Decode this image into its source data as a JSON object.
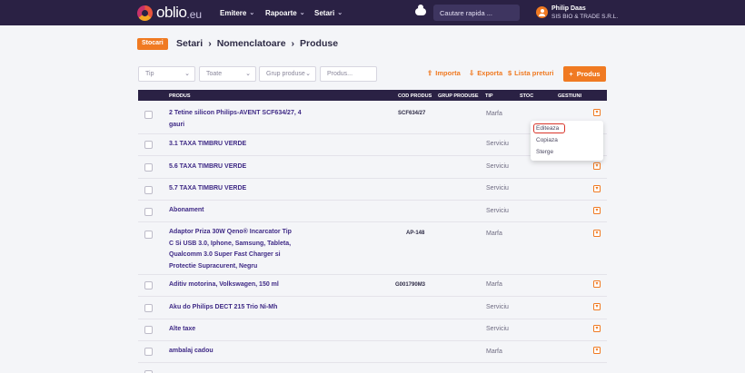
{
  "nav": {
    "logo_text": "oblio",
    "logo_tld": ".eu",
    "menu": [
      {
        "label": "Emitere"
      },
      {
        "label": "Rapoarte"
      },
      {
        "label": "Setari"
      }
    ],
    "search_placeholder": "Cautare rapida ...",
    "user_name": "Philip Daas",
    "user_company": "SIS BIO & TRADE S.R.L."
  },
  "breadcrumb": {
    "badge": "Stocari",
    "items": [
      "Setari",
      "Nomenclatoare",
      "Produse"
    ],
    "separator": "›"
  },
  "filters": {
    "tip": "Tip",
    "toate": "Toate",
    "grup": "Grup produse",
    "produs_placeholder": "Produs..."
  },
  "actions": {
    "importa": "Importa",
    "exporta": "Exporta",
    "lista_preturi": "Lista preturi",
    "add_produs": "Produs"
  },
  "table": {
    "headers": {
      "produs": "PRODUS",
      "cod": "COD PRODUS",
      "grup": "GRUP PRODUSE",
      "tip": "TIP",
      "stoc": "STOC",
      "gestiuni": "GESTIUNI"
    },
    "rows": [
      {
        "name": "2 Tetine silicon Philips-AVENT SCF634/27, 4 gauri",
        "code": "SCF634/27",
        "type": "Marfa"
      },
      {
        "name": "3.1 TAXA TIMBRU VERDE",
        "code": "",
        "type": "Serviciu"
      },
      {
        "name": "5.6 TAXA TIMBRU VERDE",
        "code": "",
        "type": "Serviciu"
      },
      {
        "name": "5.7 TAXA TIMBRU VERDE",
        "code": "",
        "type": "Serviciu"
      },
      {
        "name": "Abonament",
        "code": "",
        "type": "Serviciu"
      },
      {
        "name": "Adaptor Priza 30W Qeno® Incarcator Tip C Si USB 3.0, Iphone, Samsung, Tableta, Qualcomm 3.0 Super Fast Charger si Protectie Supracurent, Negru",
        "code": "AP-148",
        "type": "Marfa"
      },
      {
        "name": "Aditiv motorina, Volkswagen, 150 ml",
        "code": "G001790M3",
        "type": "Marfa"
      },
      {
        "name": "Aku do Philips DECT 215 Trio Ni-Mh",
        "code": "",
        "type": "Serviciu"
      },
      {
        "name": "Alte taxe",
        "code": "",
        "type": "Serviciu"
      },
      {
        "name": "ambalaj cadou",
        "code": "",
        "type": "Marfa"
      }
    ]
  },
  "row_menu": {
    "items": [
      "Editeaza",
      "Copiaza",
      "Sterge"
    ]
  },
  "colors": {
    "accent": "#f07a22",
    "navbar": "#2a2144",
    "link": "#3f2a86"
  }
}
